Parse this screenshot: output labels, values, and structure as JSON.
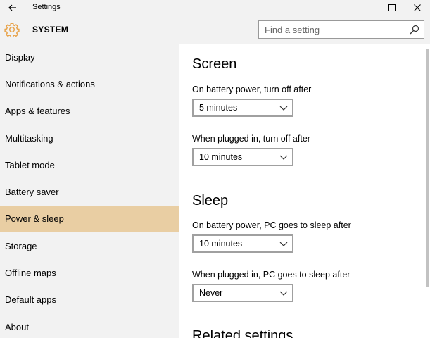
{
  "window": {
    "title": "Settings",
    "controls": [
      "minimize",
      "maximize",
      "close"
    ]
  },
  "header": {
    "icon": "gear-icon",
    "section_title": "SYSTEM",
    "search_placeholder": "Find a setting",
    "accent": "#e8a34a"
  },
  "sidebar": {
    "active_color": "#e9cea3",
    "items": [
      {
        "label": "Display"
      },
      {
        "label": "Notifications & actions"
      },
      {
        "label": "Apps & features"
      },
      {
        "label": "Multitasking"
      },
      {
        "label": "Tablet mode"
      },
      {
        "label": "Battery saver"
      },
      {
        "label": "Power & sleep",
        "active": true
      },
      {
        "label": "Storage"
      },
      {
        "label": "Offline maps"
      },
      {
        "label": "Default apps"
      },
      {
        "label": "About"
      }
    ]
  },
  "main": {
    "screen": {
      "heading": "Screen",
      "battery_label": "On battery power, turn off after",
      "battery_value": "5 minutes",
      "plugged_label": "When plugged in, turn off after",
      "plugged_value": "10 minutes"
    },
    "sleep": {
      "heading": "Sleep",
      "battery_label": "On battery power, PC goes to sleep after",
      "battery_value": "10 minutes",
      "plugged_label": "When plugged in, PC goes to sleep after",
      "plugged_value": "Never"
    },
    "related": {
      "heading": "Related settings"
    }
  }
}
